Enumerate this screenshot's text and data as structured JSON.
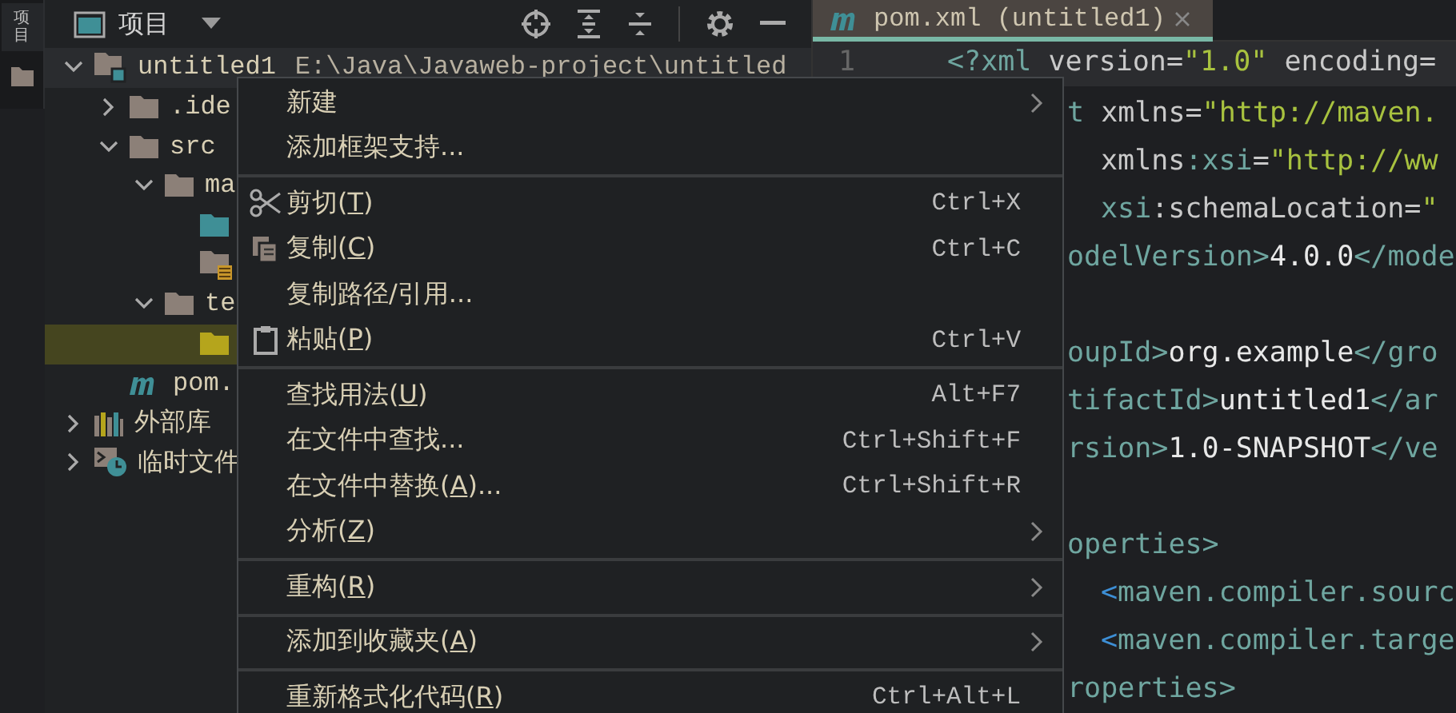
{
  "side_strip": {
    "label": "项目"
  },
  "project_panel": {
    "title": "项目"
  },
  "tree": [
    {
      "label": "untitled1",
      "path": "E:\\Java\\Javaweb-project\\untitled",
      "kind": "module",
      "expanded": true,
      "selected": false,
      "children": [
        {
          "label": ".ide",
          "kind": "folder",
          "expanded": false,
          "selected": false
        },
        {
          "label": "src",
          "kind": "folder",
          "expanded": true,
          "selected": false,
          "children": [
            {
              "label": "ma",
              "kind": "folder",
              "expanded": true,
              "selected": false,
              "children": [
                {
                  "kind": "source",
                  "selected": false
                },
                {
                  "kind": "resources",
                  "selected": false
                }
              ]
            },
            {
              "label": "te",
              "kind": "folder",
              "expanded": true,
              "selected": false,
              "children": [
                {
                  "kind": "test",
                  "selected": true
                }
              ]
            }
          ]
        },
        {
          "label": "pom.",
          "kind": "maven",
          "selected": false
        }
      ]
    },
    {
      "label": "外部库",
      "kind": "library",
      "expanded": false,
      "selected": false
    },
    {
      "label": "临时文件",
      "kind": "scratch",
      "expanded": false,
      "selected": false
    }
  ],
  "editor_tab": {
    "title": "pom.xml (untitled1)",
    "selected": true
  },
  "editor": {
    "line_number": "1",
    "lines": [
      {
        "kind": "full",
        "tokens": [
          {
            "text": "<?xml ",
            "kind": "tag"
          },
          {
            "text": "version=",
            "kind": "attr"
          },
          {
            "text": "\"1.0\"",
            "kind": "str"
          },
          {
            "text": " encoding=",
            "kind": "attr"
          }
        ]
      },
      {
        "kind": "clipped",
        "tokens": [
          {
            "text": "t ",
            "kind": "tag"
          },
          {
            "text": "xmlns=",
            "kind": "attr"
          },
          {
            "text": "\"http://maven.",
            "kind": "str"
          }
        ]
      },
      {
        "kind": "clipped",
        "indent": true,
        "tokens": [
          {
            "text": "xmlns",
            "kind": "attr"
          },
          {
            "text": ":xsi",
            "kind": "tag"
          },
          {
            "text": "=",
            "kind": "attr"
          },
          {
            "text": "\"http://ww",
            "kind": "str"
          }
        ]
      },
      {
        "kind": "clipped",
        "indent": true,
        "tokens": [
          {
            "text": "xsi",
            "kind": "tag"
          },
          {
            "text": ":schemaLocation=",
            "kind": "attr"
          },
          {
            "text": "\"",
            "kind": "str"
          }
        ]
      },
      {
        "kind": "clipped",
        "tokens": [
          {
            "text": "odelVersion>",
            "kind": "tag"
          },
          {
            "text": "4.0.0",
            "kind": "text"
          },
          {
            "text": "</mode",
            "kind": "tag"
          }
        ]
      },
      {
        "kind": "clipped",
        "blank_before": true,
        "tokens": [
          {
            "text": "oupId>",
            "kind": "tag"
          },
          {
            "text": "org.example",
            "kind": "text"
          },
          {
            "text": "</gro",
            "kind": "tag"
          }
        ]
      },
      {
        "kind": "clipped",
        "tokens": [
          {
            "text": "tifactId>",
            "kind": "tag"
          },
          {
            "text": "untitled1",
            "kind": "text"
          },
          {
            "text": "</ar",
            "kind": "tag"
          }
        ]
      },
      {
        "kind": "clipped",
        "tokens": [
          {
            "text": "rsion>",
            "kind": "tag"
          },
          {
            "text": "1.0-SNAPSHOT",
            "kind": "text"
          },
          {
            "text": "</ve",
            "kind": "tag"
          }
        ]
      },
      {
        "kind": "clipped",
        "blank_before": true,
        "tokens": [
          {
            "text": "operties>",
            "kind": "tag"
          }
        ]
      },
      {
        "kind": "clipped",
        "indent": true,
        "tokens": [
          {
            "text": "<",
            "kind": "bracket"
          },
          {
            "text": "maven.compiler.sourc",
            "kind": "tag"
          }
        ]
      },
      {
        "kind": "clipped",
        "indent": true,
        "tokens": [
          {
            "text": "<",
            "kind": "bracket"
          },
          {
            "text": "maven.compiler.targe",
            "kind": "tag"
          }
        ]
      },
      {
        "kind": "clipped",
        "tokens": [
          {
            "text": "roperties>",
            "kind": "tag"
          }
        ]
      }
    ]
  },
  "context_menu": {
    "groups": [
      [
        {
          "label": "新建",
          "submenu": true
        },
        {
          "label": "添加框架支持..."
        }
      ],
      [
        {
          "label": "剪切(",
          "mnemonic": "T",
          "after": ")",
          "kind": "cut",
          "shortcut": "Ctrl+X"
        },
        {
          "label": "复制(",
          "mnemonic": "C",
          "after": ")",
          "kind": "copy",
          "shortcut": "Ctrl+C"
        },
        {
          "label": "复制路径/引用..."
        },
        {
          "label": "粘贴(",
          "mnemonic": "P",
          "after": ")",
          "kind": "paste",
          "shortcut": "Ctrl+V"
        }
      ],
      [
        {
          "label": "查找用法(",
          "mnemonic": "U",
          "after": ")",
          "shortcut": "Alt+F7"
        },
        {
          "label": "在文件中查找...",
          "shortcut": "Ctrl+Shift+F"
        },
        {
          "label": "在文件中替换(",
          "mnemonic": "A",
          "after": ")...",
          "shortcut": "Ctrl+Shift+R"
        },
        {
          "label": "分析(",
          "mnemonic": "Z",
          "after": ")",
          "submenu": true
        }
      ],
      [
        {
          "label": "重构(",
          "mnemonic": "R",
          "after": ")",
          "submenu": true
        }
      ],
      [
        {
          "label": "添加到收藏夹(",
          "mnemonic": "A",
          "after": ")",
          "submenu": true
        }
      ],
      [
        {
          "label": "重新格式化代码(",
          "mnemonic": "R",
          "after": ")",
          "shortcut": "Ctrl+Alt+L"
        }
      ]
    ]
  }
}
